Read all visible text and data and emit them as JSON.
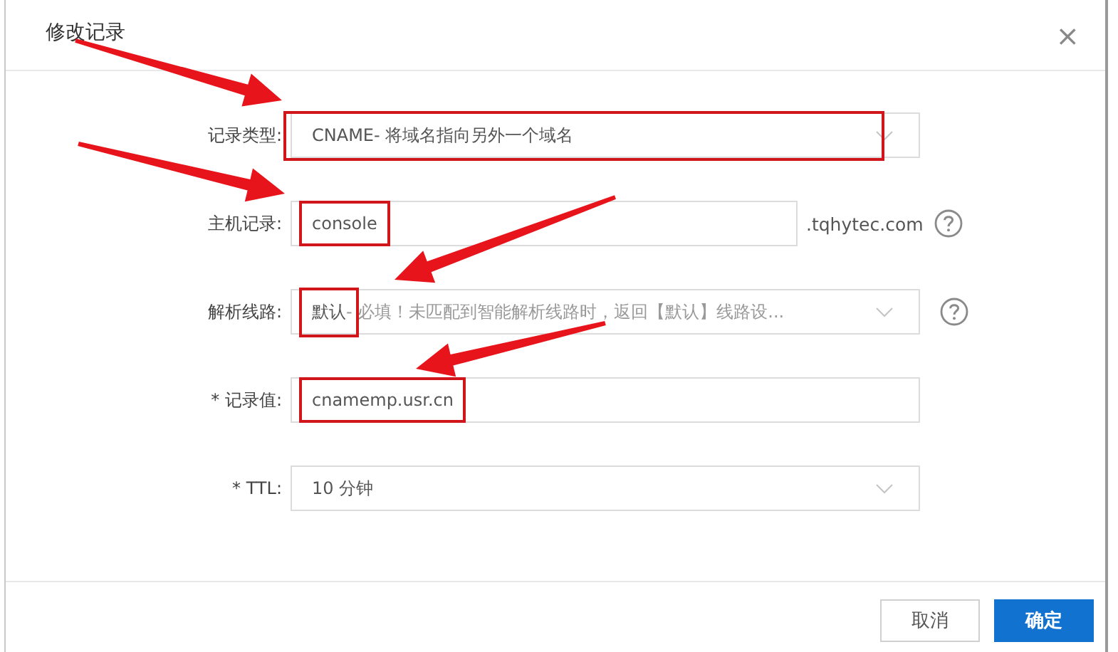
{
  "dialog": {
    "title": "修改记录",
    "close": "×"
  },
  "fields": [
    {
      "kind": "select",
      "label": "记录类型:",
      "value": "CNAME- 将域名指向另外一个域名",
      "annotated": true
    },
    {
      "kind": "input",
      "label": "主机记录:",
      "value": "console",
      "suffix": ".tqhytec.com",
      "help": true,
      "annotated": true
    },
    {
      "kind": "select",
      "label": "解析线路:",
      "value": "默认",
      "hint": " - 必填！未匹配到智能解析线路时，返回【默认】线路设...",
      "help": true,
      "annotated": true
    },
    {
      "kind": "input",
      "label": "* 记录值:",
      "value": "cnamemp.usr.cn",
      "annotated": true
    },
    {
      "kind": "select",
      "label": "* TTL:",
      "value": "10 分钟"
    }
  ],
  "buttons": [
    {
      "label": "取消",
      "primary": false
    },
    {
      "label": "确定",
      "primary": true
    }
  ]
}
